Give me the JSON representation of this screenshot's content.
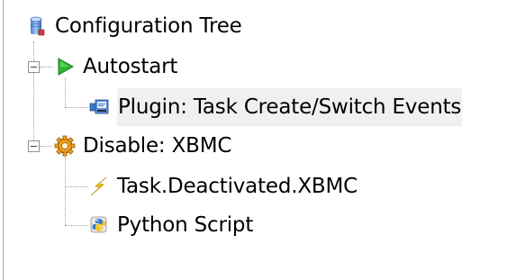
{
  "tree": {
    "root": {
      "label": "Configuration Tree",
      "icon": "configuration-tree-icon"
    },
    "nodes": [
      {
        "label": "Autostart",
        "icon": "play-icon",
        "expanded": true,
        "children": [
          {
            "label": "Plugin: Task Create/Switch Events",
            "icon": "plugin-icon",
            "selected": true
          }
        ]
      },
      {
        "label": "Disable: XBMC",
        "icon": "gear-macro-icon",
        "expanded": true,
        "children": [
          {
            "label": "Task.Deactivated.XBMC",
            "icon": "lightning-event-icon"
          },
          {
            "label": "Python Script",
            "icon": "python-script-icon"
          }
        ]
      }
    ]
  },
  "colors": {
    "play_green": "#2fb52f",
    "lightning_yellow": "#f5c518",
    "gear_orange": "#f0a020",
    "selection_bg": "#f0f0f0"
  }
}
